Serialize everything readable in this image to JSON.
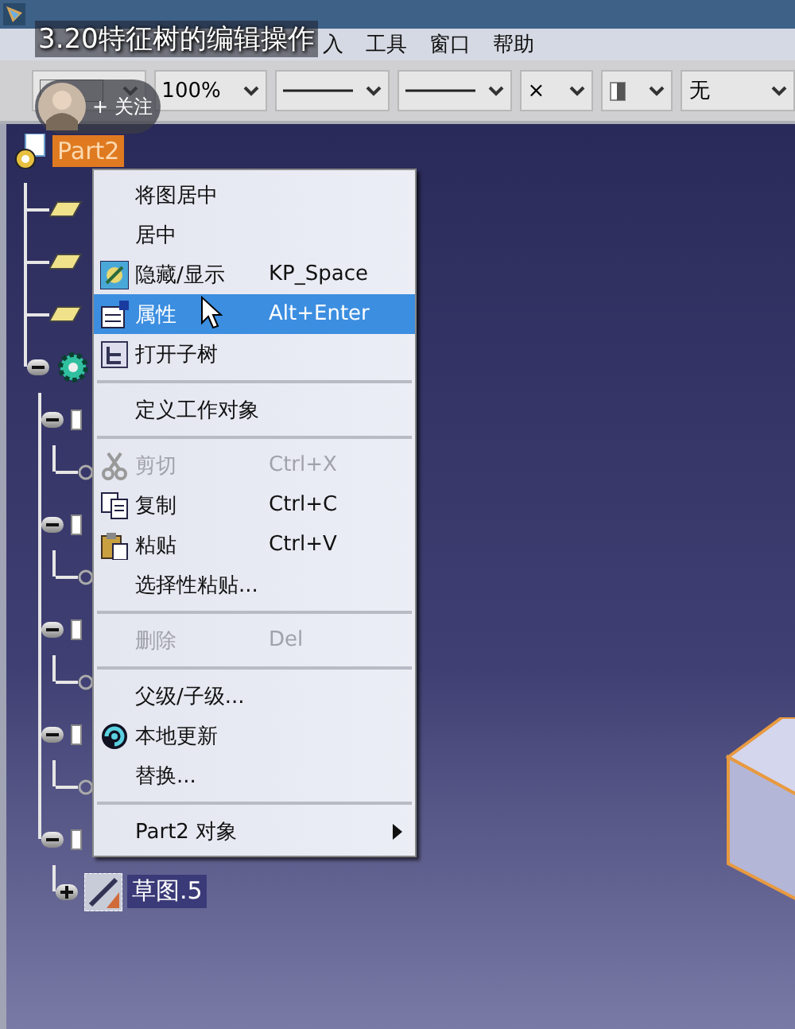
{
  "video_title": "3.20特征树的编辑操作",
  "follow_badge": {
    "plus": "+",
    "label": "关注"
  },
  "menu_bar": [
    "入",
    "工具",
    "窗口",
    "帮助"
  ],
  "toolbar": {
    "combos": [
      {
        "kind": "swatch"
      },
      {
        "kind": "text",
        "value": "100%"
      },
      {
        "kind": "line"
      },
      {
        "kind": "line"
      },
      {
        "kind": "text",
        "value": "×"
      },
      {
        "kind": "layer"
      },
      {
        "kind": "text",
        "value": "无"
      }
    ]
  },
  "tree": {
    "kind": "part",
    "label": "Part2",
    "selected": true,
    "children": [
      {
        "kind": "plane"
      },
      {
        "kind": "plane"
      },
      {
        "kind": "plane"
      },
      {
        "kind": "body",
        "expanded": true,
        "children": [
          {
            "kind": "node",
            "expanded": true,
            "children": [
              {
                "kind": "leaf"
              }
            ]
          },
          {
            "kind": "node",
            "expanded": true,
            "children": [
              {
                "kind": "leaf"
              }
            ]
          },
          {
            "kind": "node",
            "expanded": true,
            "children": [
              {
                "kind": "leaf"
              }
            ]
          },
          {
            "kind": "node",
            "expanded": true,
            "children": [
              {
                "kind": "leaf"
              }
            ]
          },
          {
            "kind": "node",
            "expanded": true,
            "children": [
              {
                "kind": "sketch",
                "label": "草图.5",
                "selected": true,
                "expanded": false
              }
            ]
          }
        ]
      }
    ]
  },
  "context_menu": [
    {
      "kind": "item",
      "label": "将图居中",
      "disabled": false,
      "selected": false
    },
    {
      "kind": "item",
      "label": "居中",
      "disabled": false,
      "selected": false
    },
    {
      "kind": "hide",
      "label": "隐藏/显示",
      "shortcut": "KP_Space",
      "disabled": false,
      "selected": false
    },
    {
      "kind": "properties",
      "label": "属性",
      "shortcut": "Alt+Enter",
      "disabled": false,
      "selected": true
    },
    {
      "kind": "tree",
      "label": "打开子树",
      "disabled": false,
      "selected": false
    },
    {
      "kind": "separator"
    },
    {
      "kind": "item",
      "label": "定义工作对象",
      "disabled": false,
      "selected": false
    },
    {
      "kind": "separator"
    },
    {
      "kind": "scissors",
      "label": "剪切",
      "shortcut": "Ctrl+X",
      "disabled": true,
      "selected": false
    },
    {
      "kind": "copy",
      "label": "复制",
      "shortcut": "Ctrl+C",
      "disabled": false,
      "selected": false
    },
    {
      "kind": "paste",
      "label": "粘贴",
      "shortcut": "Ctrl+V",
      "disabled": false,
      "selected": false
    },
    {
      "kind": "item",
      "label": "选择性粘贴...",
      "disabled": false,
      "selected": false
    },
    {
      "kind": "separator"
    },
    {
      "kind": "item",
      "label": "删除",
      "shortcut": "Del",
      "disabled": true,
      "selected": false
    },
    {
      "kind": "separator"
    },
    {
      "kind": "item",
      "label": "父级/子级...",
      "disabled": false,
      "selected": false
    },
    {
      "kind": "update",
      "label": "本地更新",
      "disabled": false,
      "selected": false
    },
    {
      "kind": "item",
      "label": "替换...",
      "disabled": false,
      "selected": false
    },
    {
      "kind": "separator"
    },
    {
      "kind": "item",
      "label": "Part2 对象",
      "submenu": true,
      "disabled": false,
      "selected": false
    }
  ]
}
